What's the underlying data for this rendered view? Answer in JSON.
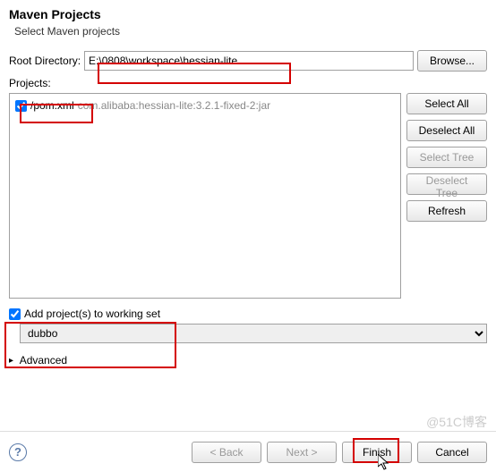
{
  "header": {
    "title": "Maven Projects",
    "subtitle": "Select Maven projects"
  },
  "rootDir": {
    "label": "Root Directory:",
    "value": "E:\\0808\\workspace\\hessian-lite",
    "browse": "Browse..."
  },
  "projects": {
    "label": "Projects:",
    "items": [
      {
        "checked": true,
        "name": "/pom.xml",
        "desc": "com.alibaba:hessian-lite:3.2.1-fixed-2:jar"
      }
    ]
  },
  "sideButtons": {
    "selectAll": "Select All",
    "deselectAll": "Deselect All",
    "selectTree": "Select Tree",
    "deselectTree": "Deselect Tree",
    "refresh": "Refresh"
  },
  "workingSet": {
    "checked": true,
    "label": "Add project(s) to working set",
    "selected": "dubbo"
  },
  "advanced": {
    "label": "Advanced"
  },
  "footer": {
    "back": "< Back",
    "next": "Next >",
    "finish": "Finish",
    "cancel": "Cancel"
  },
  "watermark": "@51C博客"
}
